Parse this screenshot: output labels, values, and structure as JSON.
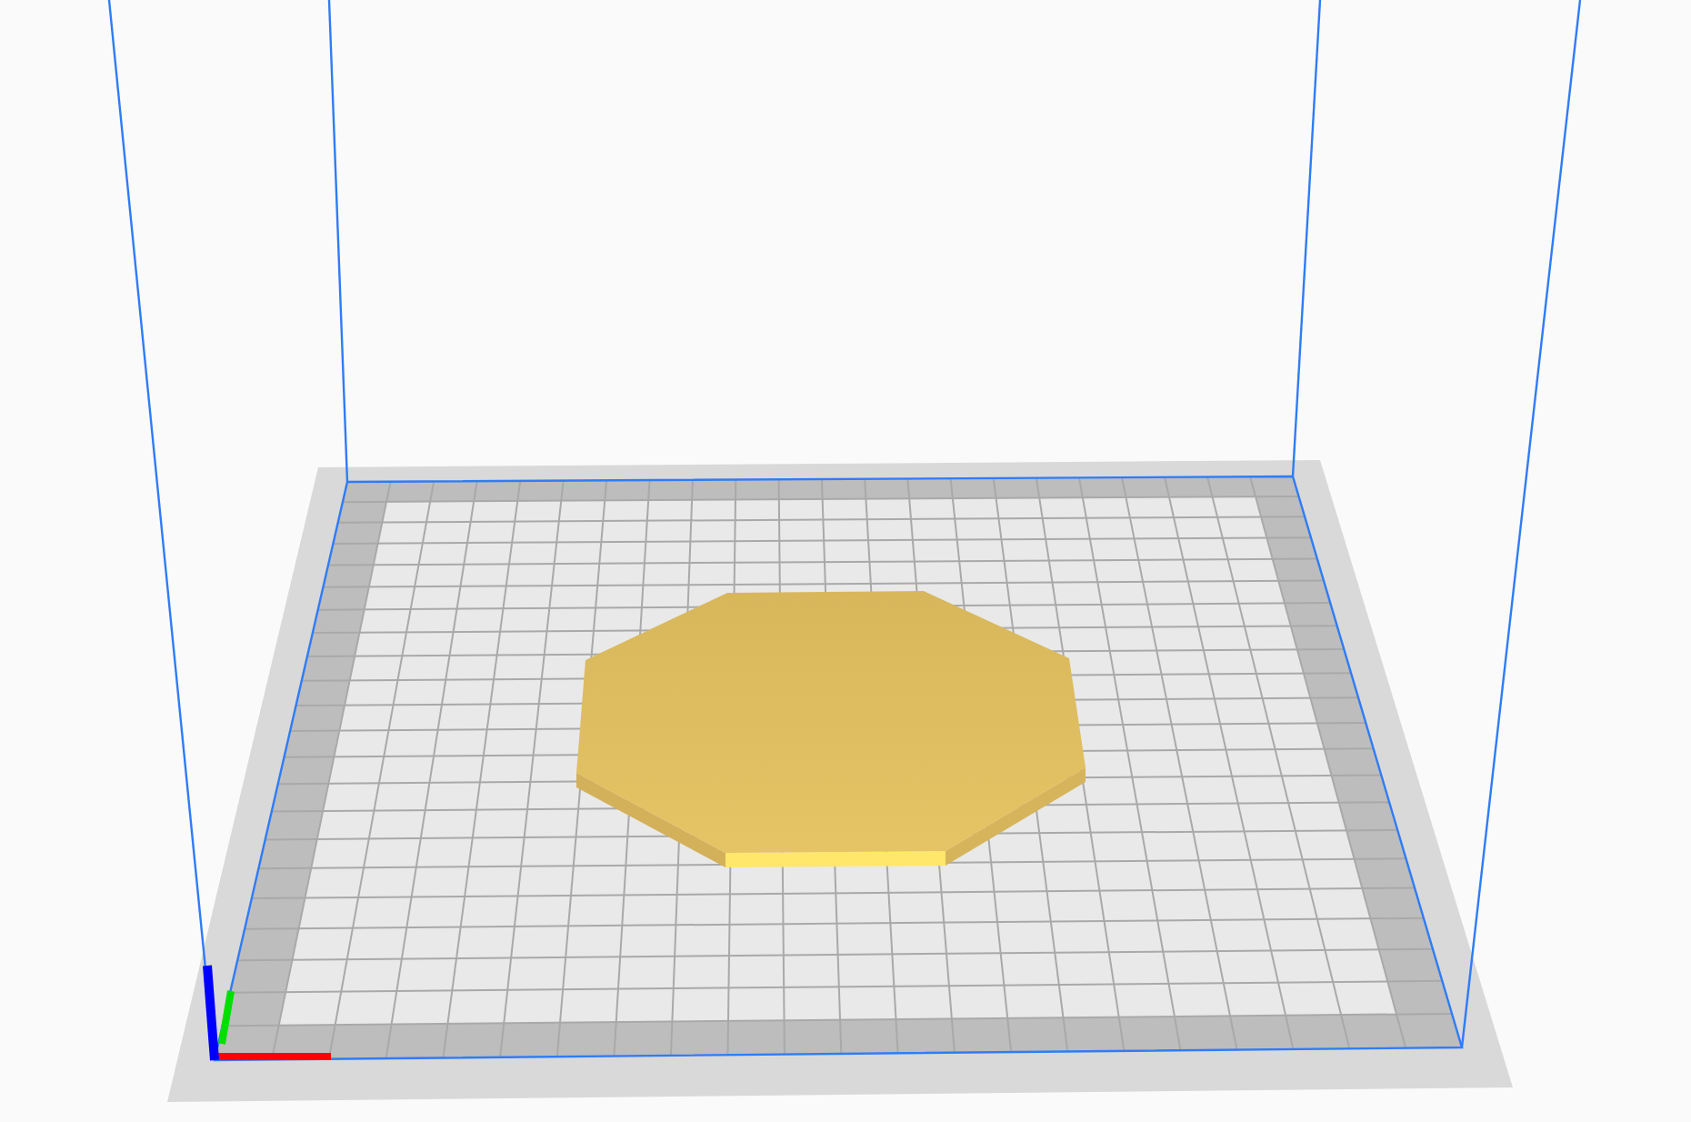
{
  "viewport": {
    "objects": [
      {
        "kind": "octagon-slab"
      }
    ]
  }
}
